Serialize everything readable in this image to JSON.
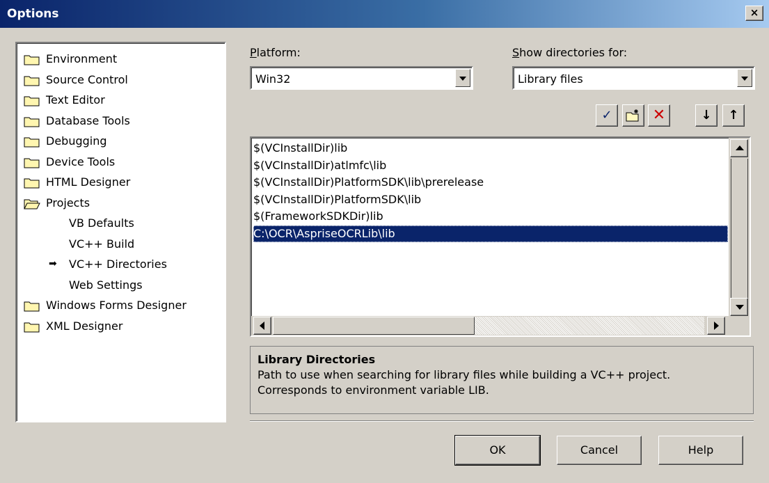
{
  "window": {
    "title": "Options",
    "close_glyph": "×"
  },
  "tree": {
    "items": [
      {
        "label": "Environment",
        "icon": "folder-icon",
        "kind": "folder"
      },
      {
        "label": "Source Control",
        "icon": "folder-icon",
        "kind": "folder"
      },
      {
        "label": "Text Editor",
        "icon": "folder-icon",
        "kind": "folder"
      },
      {
        "label": "Database Tools",
        "icon": "folder-icon",
        "kind": "folder"
      },
      {
        "label": "Debugging",
        "icon": "folder-icon",
        "kind": "folder"
      },
      {
        "label": "Device Tools",
        "icon": "folder-icon",
        "kind": "folder"
      },
      {
        "label": "HTML Designer",
        "icon": "folder-icon",
        "kind": "folder"
      },
      {
        "label": "Projects",
        "icon": "open-folder-icon",
        "kind": "folder-open"
      },
      {
        "label": "VB Defaults",
        "kind": "child"
      },
      {
        "label": "VC++ Build",
        "kind": "child"
      },
      {
        "label": "VC++ Directories",
        "kind": "child-selected"
      },
      {
        "label": "Web Settings",
        "kind": "child"
      },
      {
        "label": "Windows Forms Designer",
        "icon": "folder-icon",
        "kind": "folder"
      },
      {
        "label": "XML Designer",
        "icon": "folder-icon",
        "kind": "folder"
      }
    ]
  },
  "platform": {
    "label_accel": "P",
    "label_rest": "latform:",
    "value": "Win32"
  },
  "show_dirs": {
    "label_accel": "S",
    "label_rest": "how directories for:",
    "value": "Library files"
  },
  "toolbar": {
    "check_glyph": "✓",
    "new_folder_icon": "new-folder-icon",
    "delete_glyph": "✕",
    "down_glyph": "↓",
    "up_glyph": "↑"
  },
  "directories": [
    "$(VCInstallDir)lib",
    "$(VCInstallDir)atlmfc\\lib",
    "$(VCInstallDir)PlatformSDK\\lib\\prerelease",
    "$(VCInstallDir)PlatformSDK\\lib",
    "$(FrameworkSDKDir)lib",
    "C:\\OCR\\AspriseOCRLib\\lib"
  ],
  "selected_directory_index": 5,
  "description": {
    "heading": "Library Directories",
    "line1": "Path to use when searching for library files while building a VC++ project.",
    "line2": "Corresponds to environment variable LIB."
  },
  "buttons": {
    "ok": "OK",
    "cancel": "Cancel",
    "help": "Help"
  },
  "colors": {
    "selection": "#0a246a",
    "face": "#d4d0c8",
    "delete": "#cc0000",
    "check": "#0a246a"
  }
}
